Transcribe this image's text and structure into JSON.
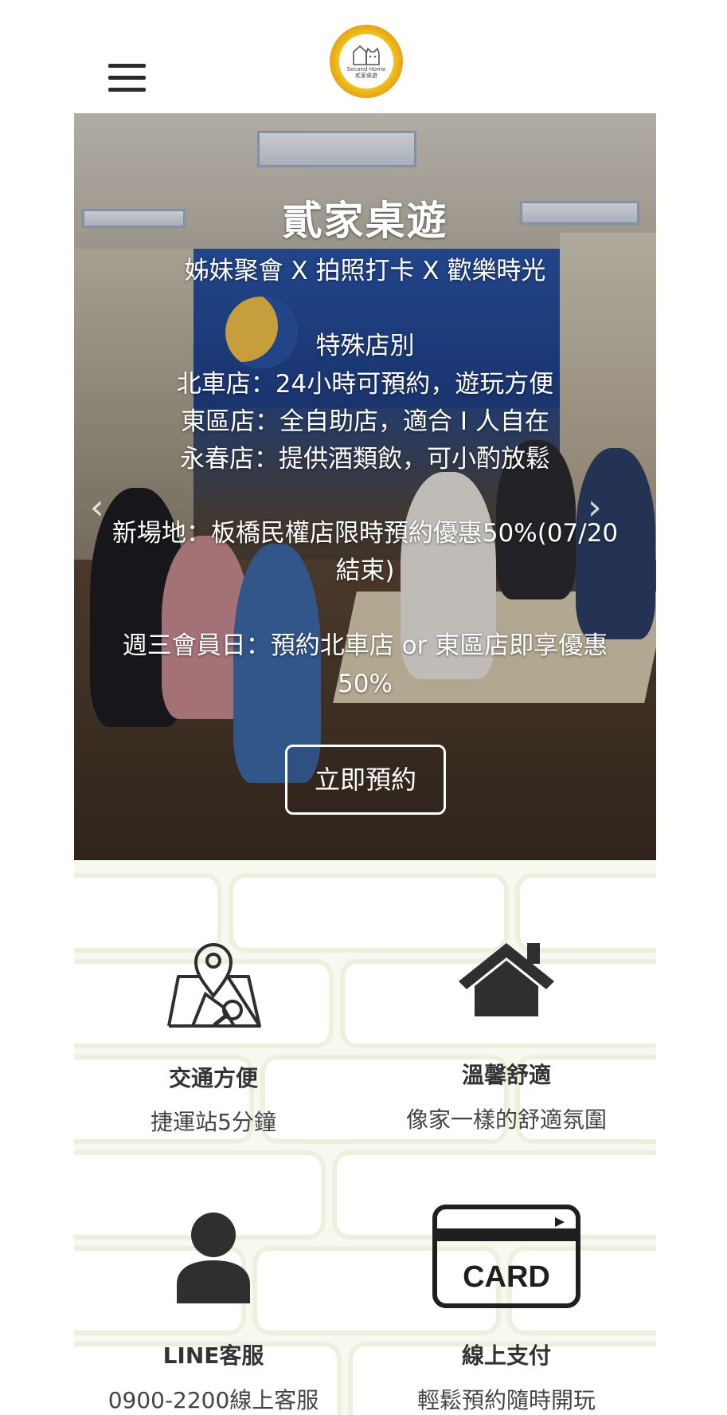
{
  "header": {
    "logo_text_en": "Second Home",
    "logo_text_zh": "貳家桌遊"
  },
  "hero": {
    "title": "貳家桌遊",
    "tagline": "姊妹聚會 X 拍照打卡 X 歡樂時光",
    "special_heading": "特殊店別",
    "store_lines": [
      "北車店：24小時可預約，遊玩方便",
      "東區店：全自助店，適合 I 人自在",
      "永春店：提供酒類飲，可小酌放鬆"
    ],
    "promo_line_1": "新場地：板橋民權店限時預約優惠50%(07/20",
    "promo_line_2": "結束)",
    "member_line_1": "週三會員日：預約北車店 or 東區店即享優惠",
    "member_line_2": "50%",
    "book_button": "立即預約",
    "prev_arrow": "‹",
    "next_arrow": "›"
  },
  "features": [
    {
      "icon": "map-pin-icon",
      "title": "交通方便",
      "desc": "捷運站5分鐘"
    },
    {
      "icon": "house-icon",
      "title": "溫馨舒適",
      "desc": "像家一樣的舒適氛圍"
    },
    {
      "icon": "user-icon",
      "title": "LINE客服",
      "desc": "0900-2200線上客服"
    },
    {
      "icon": "card-icon",
      "title": "線上支付",
      "desc": "輕鬆預約隨時開玩",
      "card_label": "CARD"
    }
  ],
  "colors": {
    "icon": "#2f2f2f",
    "logo_ring": "#f2c21b",
    "background_bricks": "#f7f8ef"
  }
}
